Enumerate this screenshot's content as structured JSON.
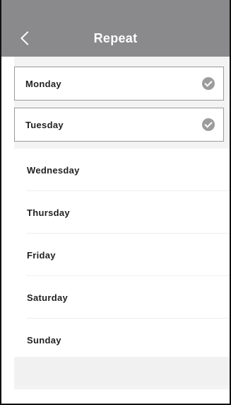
{
  "header": {
    "title": "Repeat",
    "back_icon": "chevron-left-icon",
    "background_color": "#8a8a8d"
  },
  "days": [
    {
      "label": "Monday",
      "selected": true
    },
    {
      "label": "Tuesday",
      "selected": true
    },
    {
      "label": "Wednesday",
      "selected": false
    },
    {
      "label": "Thursday",
      "selected": false
    },
    {
      "label": "Friday",
      "selected": false
    },
    {
      "label": "Saturday",
      "selected": false
    },
    {
      "label": "Sunday",
      "selected": false
    }
  ],
  "check_icon": "check-circle-icon",
  "colors": {
    "selected_check": "#9c9c9c",
    "list_background": "#f3f3f4"
  }
}
